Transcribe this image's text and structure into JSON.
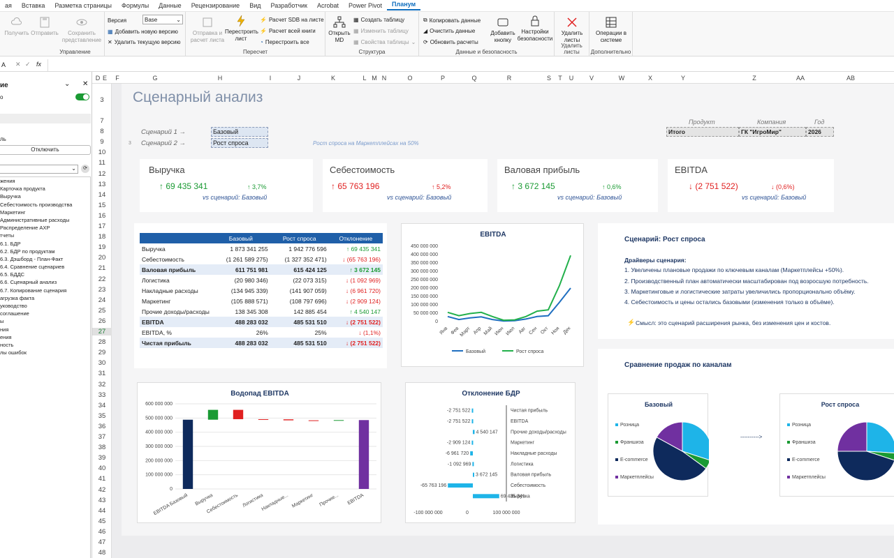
{
  "menu": {
    "items": [
      "ая",
      "Вставка",
      "Разметка страницы",
      "Формулы",
      "Данные",
      "Рецензирование",
      "Вид",
      "Разработчик",
      "Acrobat",
      "Power Pivot"
    ],
    "active": "Планум"
  },
  "ribbon": {
    "upravlenie": {
      "get": "Получить",
      "send": "Отправить",
      "keep": "Сохранить представление",
      "version_label": "Версия",
      "version_value": "Base",
      "add_version": "Добавить новую версию",
      "del_version": "Удалить текущую версию",
      "group": "Управление"
    },
    "recalc": {
      "send_calc": "Отправка и расчет листа",
      "rebuild": "Перестроить лист",
      "sdb": "Расчет SDB на листе",
      "all": "Расчет всей книги",
      "rebuild_all": "Перестроить все",
      "group": "Пересчет"
    },
    "struct": {
      "open_md": "Открыть MD",
      "create_table": "Создать таблицу",
      "change_table": "Изменить таблицу",
      "table_props": "Свойства таблицы",
      "group": "Структура"
    },
    "data": {
      "copy": "Копировать данные",
      "clear": "Очистить данные",
      "refresh": "Обновить расчеты",
      "group": "Данные и безопасность",
      "add_btn": "Добавить кнопку",
      "sec": "Настройки безопасности"
    },
    "del": {
      "label": "Удалить листы",
      "group": "Удалить листы"
    },
    "ops": {
      "label": "Операции в системе",
      "group": "Дополнительно"
    }
  },
  "formula": {
    "cell_ref": "A",
    "fx": "fx",
    "value": ""
  },
  "pane": {
    "title": "ие",
    "toggle": "о",
    "label_e": "ль",
    "disconnect": "Отключить",
    "tree": [
      "жения",
      "Карточка продукта",
      "Выручка",
      "Себестоимость производства",
      "Маркетинг",
      "Административные расходы",
      "Распределение АХР",
      "тчеты",
      "6.1. БДР",
      "6.2. БДР по продуктам",
      "6.3. Дэшборд - План-Факт",
      "6.4. Сравнение сценариев",
      "6.5. БДДС",
      "6.6. Сценарный анализ",
      "6.7. Копирование сценария",
      "агрузка факта",
      "уководство",
      "соглашение",
      "ы",
      "ния",
      "ения",
      "ность",
      "лы ошибок"
    ]
  },
  "columns": [
    "D",
    "E",
    "F",
    "G",
    "H",
    "I",
    "J",
    "K",
    "L",
    "M",
    "N",
    "O",
    "P",
    "Q",
    "R",
    "S",
    "T",
    "U",
    "V",
    "W",
    "X",
    "Y",
    "Z",
    "AA",
    "AB"
  ],
  "rows": [
    "3",
    "7",
    "8",
    "9",
    "10",
    "11",
    "12",
    "13",
    "14",
    "15",
    "16",
    "17",
    "18",
    "19",
    "20",
    "21",
    "22",
    "23",
    "24",
    "25",
    "26",
    "27",
    "28",
    "29",
    "30",
    "31",
    "32",
    "33",
    "34",
    "35",
    "36",
    "37",
    "38",
    "39",
    "40",
    "41",
    "42",
    "43",
    "44",
    "45",
    "46",
    "47",
    "48"
  ],
  "dashboard": {
    "title": "Сценарный анализ",
    "scenario1_label": "Сценарий 1 →",
    "scenario1_value": "Базовый",
    "scenario2_label": "Сценарий 2 →",
    "scenario2_value": "Рост спроса",
    "row_num": "3",
    "scenario_note": "Рост спроса на Маркетплейсах на 50%",
    "filter_headers": [
      "Продукт",
      "Компания",
      "Год"
    ],
    "filter_values": [
      "Итого",
      "ГК \"ИгроМир\"",
      "2026"
    ],
    "kpis": [
      {
        "title": "Выручка",
        "value": "↑ 69 435 341",
        "pct": "↑ 3,7%",
        "vs": "vs сценарий: Базовый",
        "dir": "up"
      },
      {
        "title": "Себестоимость",
        "value": "↑ 65 763 196",
        "pct": "↑ 5,2%",
        "vs": "vs сценарий: Базовый",
        "dir": "down"
      },
      {
        "title": "Валовая прибыль",
        "value": "↑ 3 672 145",
        "pct": "↑ 0,6%",
        "vs": "vs сценарий: Базовый",
        "dir": "up"
      },
      {
        "title": "EBITDA",
        "value": "↓ (2 751 522)",
        "pct": "↓ (0,6%)",
        "vs": "vs сценарий: Базовый",
        "dir": "down"
      }
    ],
    "table": {
      "headers": [
        "",
        "Базовый",
        "Рост спроса",
        "Отклонение"
      ],
      "rows": [
        {
          "name": "Выручка",
          "a": "1 873 341 255",
          "b": "1 942 776 596",
          "d": "↑ 69 435 341",
          "c": "green",
          "style": ""
        },
        {
          "name": "Себестоимость",
          "a": "(1 261 589 275)",
          "b": "(1 327 352 471)",
          "d": "↓ (65 763 196)",
          "c": "red",
          "style": ""
        },
        {
          "name": "Валовая прибыль",
          "a": "611 751 981",
          "b": "615 424 125",
          "d": "↑ 3 672 145",
          "c": "green",
          "style": "bold hl"
        },
        {
          "name": "Логистика",
          "a": "(20 980 346)",
          "b": "(22 073 315)",
          "d": "↓ (1 092 969)",
          "c": "red",
          "style": ""
        },
        {
          "name": "Накладные расходы",
          "a": "(134 945 339)",
          "b": "(141 907 059)",
          "d": "↓ (6 961 720)",
          "c": "red",
          "style": ""
        },
        {
          "name": "Маркетинг",
          "a": "(105 888 571)",
          "b": "(108 797 696)",
          "d": "↓ (2 909 124)",
          "c": "red",
          "style": ""
        },
        {
          "name": "Прочие доходы/расходы",
          "a": "138 345 308",
          "b": "142 885 454",
          "d": "↑ 4 540 147",
          "c": "green",
          "style": ""
        },
        {
          "name": "EBITDA",
          "a": "488 283 032",
          "b": "485 531 510",
          "d": "↓ (2 751 522)",
          "c": "red",
          "style": "bold hl"
        },
        {
          "name": "EBITDA, %",
          "a": "26%",
          "b": "25%",
          "d": "↓ (1,1%)",
          "c": "red",
          "style": ""
        },
        {
          "name": "Чистая прибыль",
          "a": "488 283 032",
          "b": "485 531 510",
          "d": "↓ (2 751 522)",
          "c": "red",
          "style": "bold hl"
        }
      ]
    },
    "scenario_box": {
      "title": "Сценарий: Рост спроса",
      "drivers_title": "Драйверы сценария:",
      "drivers": [
        "1. Увеличены плановые продажи по ключевым каналам (Маркетплейсы +50%).",
        "2. Производственный план автоматически масштабирован под возросшую потребность.",
        "3. Маркетинговые и логистические затраты увеличились пропорционально объёму.",
        "4. Себестоимость и цены остались базовыми (изменения только в объёме)."
      ],
      "meaning": "Смысл: это сценарий расширения рынка, без изменения цен и костов."
    },
    "channels_title": "Сравнение продаж по каналам",
    "arrow": "---------->"
  },
  "colors": {
    "accent": "#1f5fa8",
    "green": "#1a9a33",
    "red": "#e02020",
    "navy": "#0e2a5c",
    "cyan": "#1eb4e8",
    "purple": "#7030a0",
    "line_green": "#22b04b"
  },
  "chart_data": [
    {
      "type": "line",
      "title": "EBITDA",
      "categories": [
        "Янв",
        "Фев",
        "Март",
        "Апр",
        "Май",
        "Июн",
        "Июл",
        "Авг",
        "Сен",
        "Окт",
        "Ноя",
        "Дек"
      ],
      "ylim": [
        0,
        450000000
      ],
      "yticks": [
        "0",
        "50 000 000",
        "100 000 000",
        "150 000 000",
        "200 000 000",
        "250 000 000",
        "300 000 000",
        "350 000 000",
        "400 000 000",
        "450 000 000"
      ],
      "series": [
        {
          "name": "Базовый",
          "color": "#1f6fc0",
          "values": [
            30000000,
            12000000,
            22000000,
            28000000,
            12000000,
            3000000,
            5000000,
            15000000,
            30000000,
            35000000,
            115000000,
            200000000
          ]
        },
        {
          "name": "Рост спроса",
          "color": "#22b04b",
          "values": [
            55000000,
            35000000,
            48000000,
            55000000,
            30000000,
            8000000,
            10000000,
            30000000,
            62000000,
            70000000,
            215000000,
            395000000
          ]
        }
      ],
      "legend": "bottom"
    },
    {
      "type": "bar",
      "title": "Водопад EBITDA",
      "categories": [
        "EBITDA Базовый",
        "Выручка",
        "Себестоимость",
        "Логистика",
        "Накладные...",
        "Маркетинг",
        "Прочие...",
        "EBITDA"
      ],
      "values": [
        488283032,
        69435341,
        -65763196,
        -1092969,
        -6961720,
        -2909124,
        4540147,
        485531510
      ],
      "ylim": [
        0,
        600000000
      ],
      "yticks": [
        "0",
        "100 000 000",
        "200 000 000",
        "300 000 000",
        "400 000 000",
        "500 000 000",
        "600 000 000"
      ]
    },
    {
      "type": "bar",
      "title": "Отклонение БДР",
      "orientation": "horizontal",
      "categories": [
        "Чистая прибыль",
        "EBITDA",
        "Прочие доходы/расходы",
        "Маркетинг",
        "Накладные расходы",
        "Логистика",
        "Валовая прибыль",
        "Себестоимость",
        "Выручка"
      ],
      "values": [
        -2751522,
        -2751522,
        4540147,
        -2909124,
        -6961720,
        -1092969,
        3672145,
        -65763196,
        69435341
      ],
      "labels": [
        "-2 751 522",
        "-2 751 522",
        "4 540 147",
        "-2 909 124",
        "-6 961 720",
        "-1 092 969",
        "3 672 145",
        "-65 763 196",
        "69 435 341"
      ],
      "xlim": [
        -100000000,
        100000000
      ],
      "xticks": [
        "-100 000 000",
        "0",
        "100 000 000"
      ]
    },
    {
      "type": "pie",
      "title": "Базовый",
      "categories": [
        "Розница",
        "Франшиза",
        "E-commerce",
        "Маркетплейсы"
      ],
      "values": [
        30,
        5,
        48,
        17
      ],
      "colors": [
        "#1eb4e8",
        "#1a9a33",
        "#0e2a5c",
        "#7030a0"
      ]
    },
    {
      "type": "pie",
      "title": "Рост спроса",
      "categories": [
        "Розница",
        "Франшиза",
        "E-commerce",
        "Маркетплейсы"
      ],
      "values": [
        26,
        4,
        45,
        25
      ],
      "colors": [
        "#1eb4e8",
        "#1a9a33",
        "#0e2a5c",
        "#7030a0"
      ]
    }
  ]
}
